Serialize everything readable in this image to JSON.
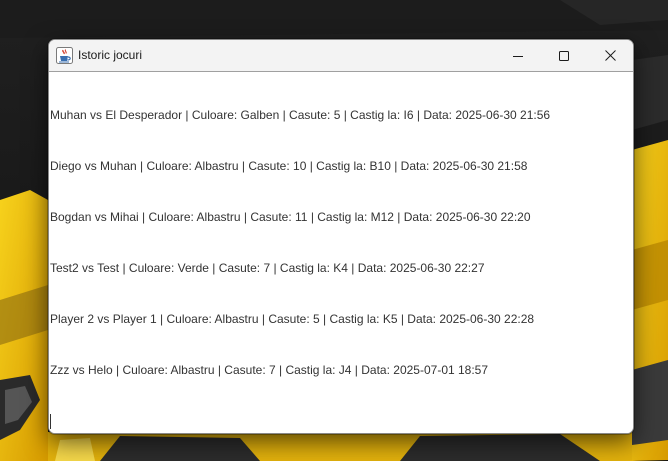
{
  "window": {
    "title": "Istoric jocuri",
    "app_icon": "java-cup-icon",
    "controls": {
      "minimize_icon": "minimize-icon",
      "maximize_icon": "maximize-icon",
      "close_icon": "close-icon"
    }
  },
  "history": {
    "entries": [
      "Muhan vs El Desperador | Culoare: Galben | Casute: 5 | Castig la: I6 | Data: 2025-06-30 21:56",
      "Diego vs Muhan | Culoare: Albastru | Casute: 10 | Castig la: B10 | Data: 2025-06-30 21:58",
      "Bogdan vs Mihai | Culoare: Albastru | Casute: 11 | Castig la: M12 | Data: 2025-06-30 22:20",
      "Test2 vs Test | Culoare: Verde | Casute: 7 | Castig la: K4 | Data: 2025-06-30 22:27",
      "Player 2 vs Player 1 | Culoare: Albastru | Casute: 5 | Castig la: K5 | Data: 2025-06-30 22:28",
      "Zzz vs Helo | Culoare: Albastru | Casute: 7 | Castig la: J4 | Data: 2025-07-01 18:57"
    ]
  },
  "colors": {
    "titlebar_bg": "#f3f3f3",
    "text": "#333333",
    "wallpaper_dark": "#1a1a1a",
    "wallpaper_yellow": "#f2c00e"
  }
}
